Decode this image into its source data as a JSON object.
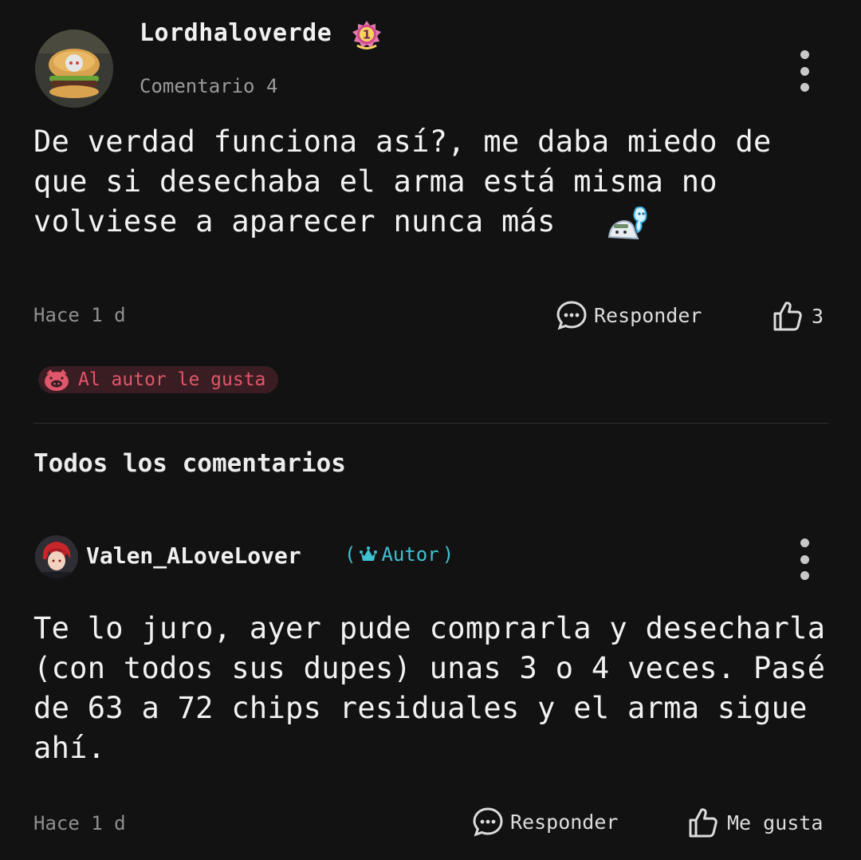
{
  "comment": {
    "username": "Lordhaloverde",
    "level": "1",
    "label": "Comentario 4",
    "text": "De verdad funciona así?, me daba miedo de que si desechaba el arma está misma no volviese a aparecer nunca más",
    "time": "Hace 1 d",
    "reply_label": "Responder",
    "like_count": "3",
    "author_likes_label": "Al autor le gusta"
  },
  "section_title": "Todos los comentarios",
  "reply": {
    "username": "Valen_ALoveLover",
    "author_open": "(",
    "author_tag": "Autor",
    "author_close": ")",
    "text": "Te lo juro, ayer pude comprarla y desecharla (con todos sus dupes) unas 3 o 4 veces. Pasé de 63 a 72 chips residuales y el arma sigue ahí.",
    "time": "Hace 1 d",
    "reply_label": "Responder",
    "like_label": "Me gusta"
  },
  "icons": {
    "more": "more-vertical-icon",
    "reply": "chat-bubble-icon",
    "like": "thumbs-up-icon",
    "author_like": "pig-face-icon",
    "author_badge": "crown-icon"
  },
  "colors": {
    "background": "#121212",
    "author_accent": "#3ec1d3",
    "author_like_accent": "#e0566a"
  }
}
